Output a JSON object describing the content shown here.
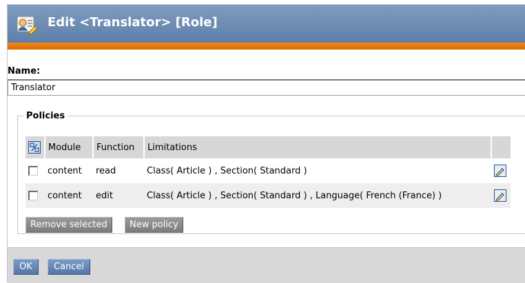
{
  "header": {
    "title": "Edit <Translator> [Role]",
    "icon": "role-edit-icon",
    "colors": {
      "title_bg": "#6f8db7",
      "accent_bar": "#e87800"
    }
  },
  "name_field": {
    "label": "Name:",
    "value": "Translator"
  },
  "policies": {
    "legend": "Policies",
    "columns": [
      "Module",
      "Function",
      "Limitations"
    ],
    "rows": [
      {
        "module": "content",
        "function": "read",
        "limitations": "Class( Article ) , Section( Standard )"
      },
      {
        "module": "content",
        "function": "edit",
        "limitations": "Class( Article ) , Section( Standard ) , Language( French (France) )"
      }
    ],
    "remove_selected_label": "Remove selected",
    "new_policy_label": "New policy"
  },
  "footer": {
    "ok_label": "OK",
    "cancel_label": "Cancel"
  }
}
